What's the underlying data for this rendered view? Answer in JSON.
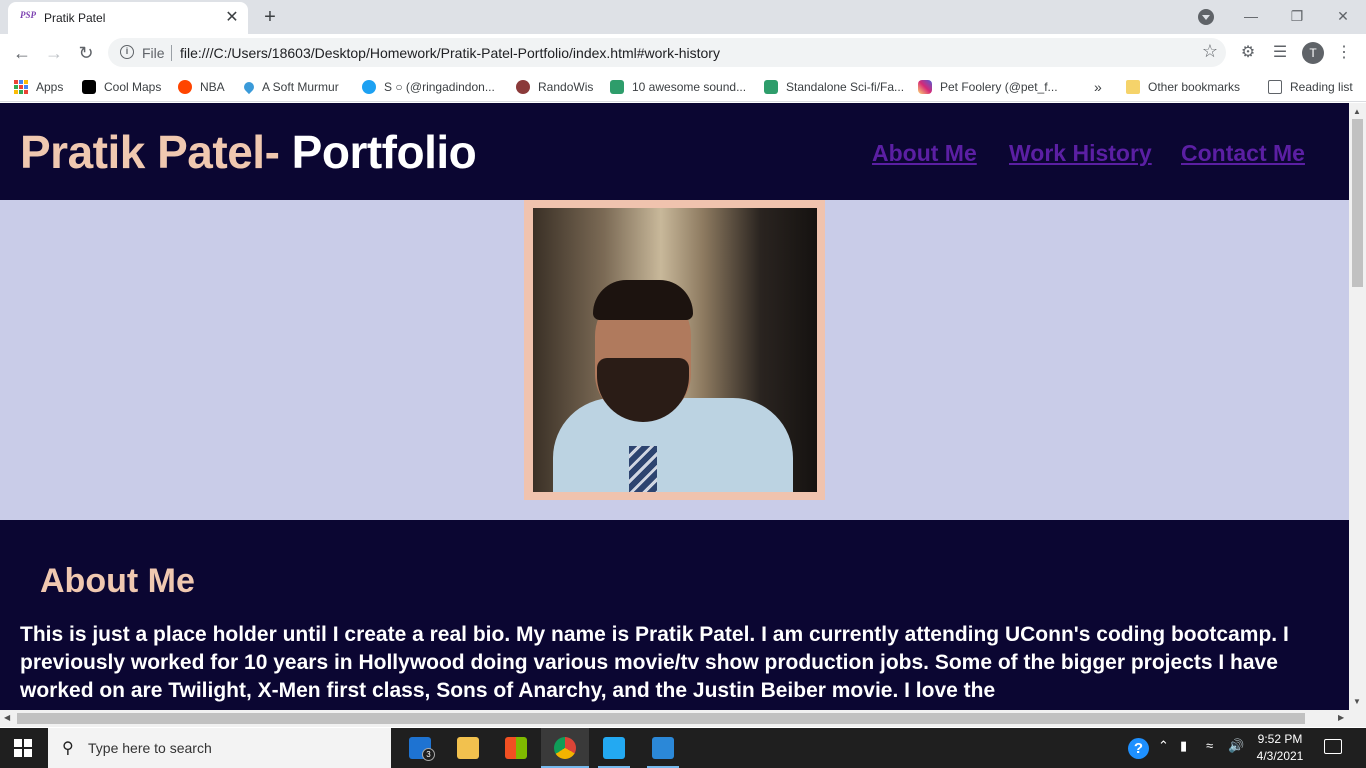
{
  "browser": {
    "tab": {
      "title": "Pratik Patel",
      "favicon_text": "PSP",
      "close": "✕"
    },
    "new_tab": "+",
    "omnibox": {
      "scheme_label": "File",
      "url": "file:///C:/Users/18603/Desktop/Homework/Pratik-Patel-Portfolio/index.html#work-history"
    },
    "profile_initial": "T",
    "bookmarks": [
      {
        "label": "Apps",
        "icon": "apps-grid-icon"
      },
      {
        "label": "Cool Maps",
        "icon": "map-icon",
        "color": "#000000"
      },
      {
        "label": "NBA",
        "icon": "reddit-icon",
        "color": "#ff4500"
      },
      {
        "label": "A Soft Murmur",
        "icon": "drop-icon",
        "color": "#3a9ad9"
      },
      {
        "label": "S ○ (@ringadindon...",
        "icon": "twitter-icon",
        "color": "#1da1f2"
      },
      {
        "label": "RandoWis",
        "icon": "bear-icon",
        "color": "#8b3a3a"
      },
      {
        "label": "10 awesome sound...",
        "icon": "site-icon",
        "color": "#2e9d6b"
      },
      {
        "label": "Standalone Sci-fi/Fa...",
        "icon": "site-icon",
        "color": "#2e9d6b"
      },
      {
        "label": "Pet Foolery (@pet_f...",
        "icon": "instagram-icon",
        "color": "#d62976"
      }
    ],
    "bookmarks_overflow": "»",
    "other_bookmarks": "Other bookmarks",
    "reading_list": "Reading list"
  },
  "site": {
    "title_part1": "Pratik Patel-",
    "title_part2": " Portfolio",
    "nav": [
      "About Me",
      "Work History",
      "Contact Me"
    ],
    "about_heading": "About Me",
    "about_text": "This is just a place holder until I create a real bio. My name is Pratik Patel. I am currently attending UConn's coding bootcamp. I previously worked for 10 years in Hollywood doing various movie/tv show production jobs. Some of the bigger projects I have worked on are Twilight, X-Men first class, Sons of Anarchy, and the Justin Beiber movie. I love the",
    "colors": {
      "header_bg": "#0b0632",
      "hero_bg": "#c9cce8",
      "accent": "#f0c8b0",
      "link": "#5b1fa3"
    }
  },
  "taskbar": {
    "search_placeholder": "Type here to search",
    "mail_badge": "3",
    "time": "9:52 PM",
    "date": "4/3/2021",
    "apps": [
      "mail-icon",
      "file-explorer-icon",
      "store-icon",
      "chrome-icon",
      "vscode-icon",
      "photos-icon"
    ]
  }
}
